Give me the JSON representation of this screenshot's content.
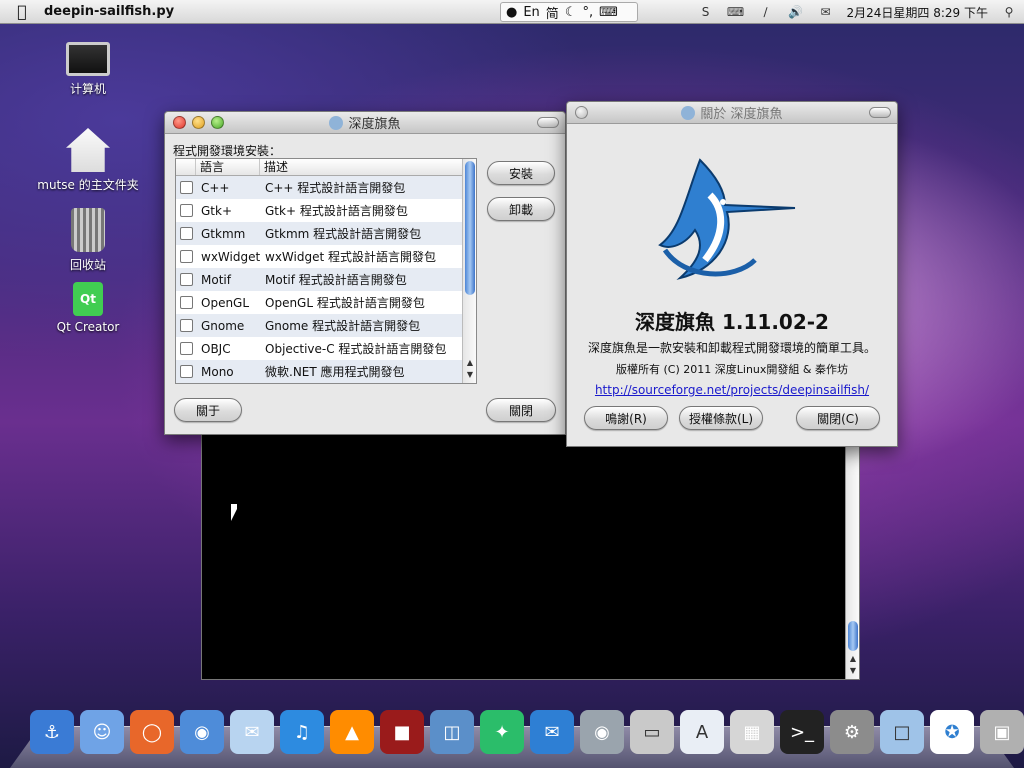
{
  "menubar": {
    "app_name": "deepin-sailfish.py",
    "ime": {
      "lang": "En",
      "script": "简"
    },
    "clock": "2月24日星期四  8:29 下午"
  },
  "desktop": {
    "icons": [
      {
        "label": "计算机"
      },
      {
        "label": "mutse 的主文件夹"
      },
      {
        "label": "回收站"
      },
      {
        "label": "Qt Creator"
      }
    ]
  },
  "install_window": {
    "title": "深度旗魚",
    "section_label": "程式開發環境安裝：",
    "columns": [
      "語言",
      "描述"
    ],
    "rows": [
      {
        "lang": "C++",
        "desc": "C++ 程式設計語言開發包"
      },
      {
        "lang": "Gtk+",
        "desc": "Gtk+ 程式設計語言開發包"
      },
      {
        "lang": "Gtkmm",
        "desc": "Gtkmm 程式設計語言開發包"
      },
      {
        "lang": "wxWidget",
        "desc": "wxWidget 程式設計語言開發包"
      },
      {
        "lang": "Motif",
        "desc": "Motif 程式設計語言開發包"
      },
      {
        "lang": "OpenGL",
        "desc": "OpenGL 程式設計語言開發包"
      },
      {
        "lang": "Gnome",
        "desc": "Gnome 程式設計語言開發包"
      },
      {
        "lang": "OBJC",
        "desc": "Objective-C 程式設計語言開發包"
      },
      {
        "lang": "Mono",
        "desc": "微軟.NET 應用程式開發包"
      }
    ],
    "install_label": "安裝",
    "uninstall_label": "卸載",
    "about_label": "關于",
    "close_label": "關閉"
  },
  "about_window": {
    "title": "關於 深度旗魚",
    "app_title": "深度旗魚  1.11.02-2",
    "description": "深度旗魚是一款安裝和卸載程式開發環境的簡單工具。",
    "copyright": "版權所有 (C) 2011 深度Linux開發組 & 秦作坊",
    "url": "http://sourceforge.net/projects/deepinsailfish/",
    "credits_label": "鳴謝(R)",
    "license_label": "授權條款(L)",
    "close_label": "關閉(C)"
  },
  "dock": {
    "items": [
      "anchor-icon",
      "finder-icon",
      "firefox-icon",
      "chrome-icon",
      "mail-stamp-icon",
      "itunes-icon",
      "vlc-icon",
      "photo-booth-icon",
      "iphoto-icon",
      "feather-icon",
      "email-icon",
      "camera-icon",
      "scanner-icon",
      "textedit-icon",
      "calculator-icon",
      "terminal-icon",
      "settings-icon",
      "folder-icon",
      "sailfish-icon",
      "trash-icon"
    ]
  }
}
